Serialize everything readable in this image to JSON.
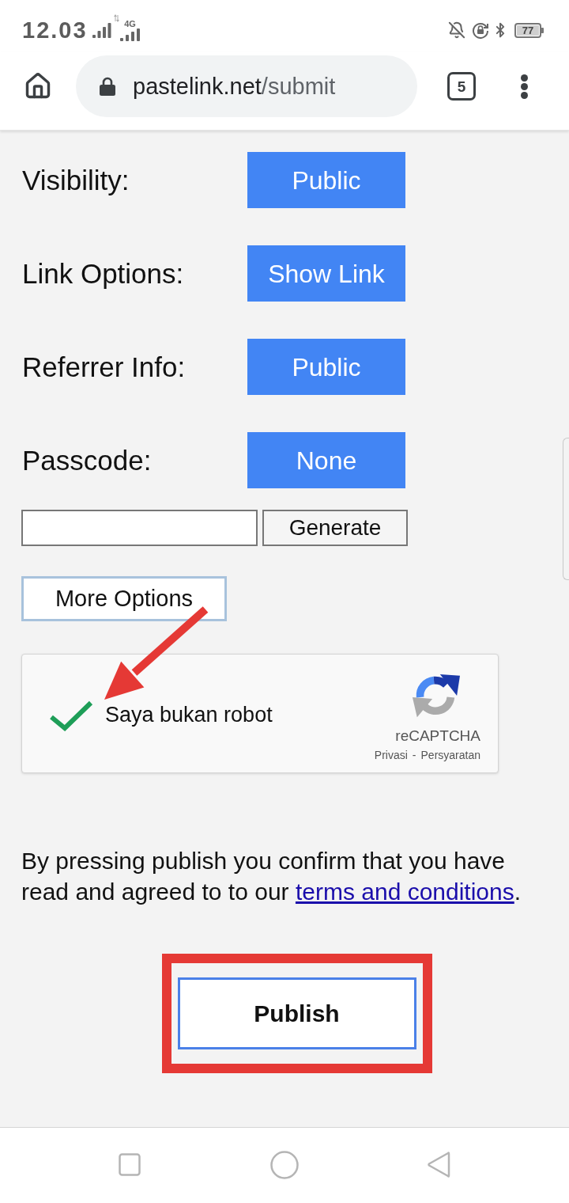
{
  "status_bar": {
    "time": "12.03",
    "network_type": "4G",
    "battery": "77"
  },
  "browser_toolbar": {
    "url_host": "pastelink.net",
    "url_path": "/submit",
    "tab_count": "5"
  },
  "options": [
    {
      "label": "Visibility:",
      "value": "Public"
    },
    {
      "label": "Link Options:",
      "value": "Show Link"
    },
    {
      "label": "Referrer Info:",
      "value": "Public"
    },
    {
      "label": "Passcode:",
      "value": "None"
    }
  ],
  "passcode_generator": {
    "button": "Generate"
  },
  "more_options_button": "More Options",
  "captcha": {
    "checked": true,
    "label": "Saya bukan robot",
    "brand": "reCAPTCHA",
    "privacy_link": "Privasi",
    "separator": "-",
    "terms_link": "Persyaratan"
  },
  "notice": {
    "text": "By pressing publish you confirm that you have read and agreed to to our ",
    "link": "terms and conditions",
    "end": "."
  },
  "publish_button": "Publish"
}
